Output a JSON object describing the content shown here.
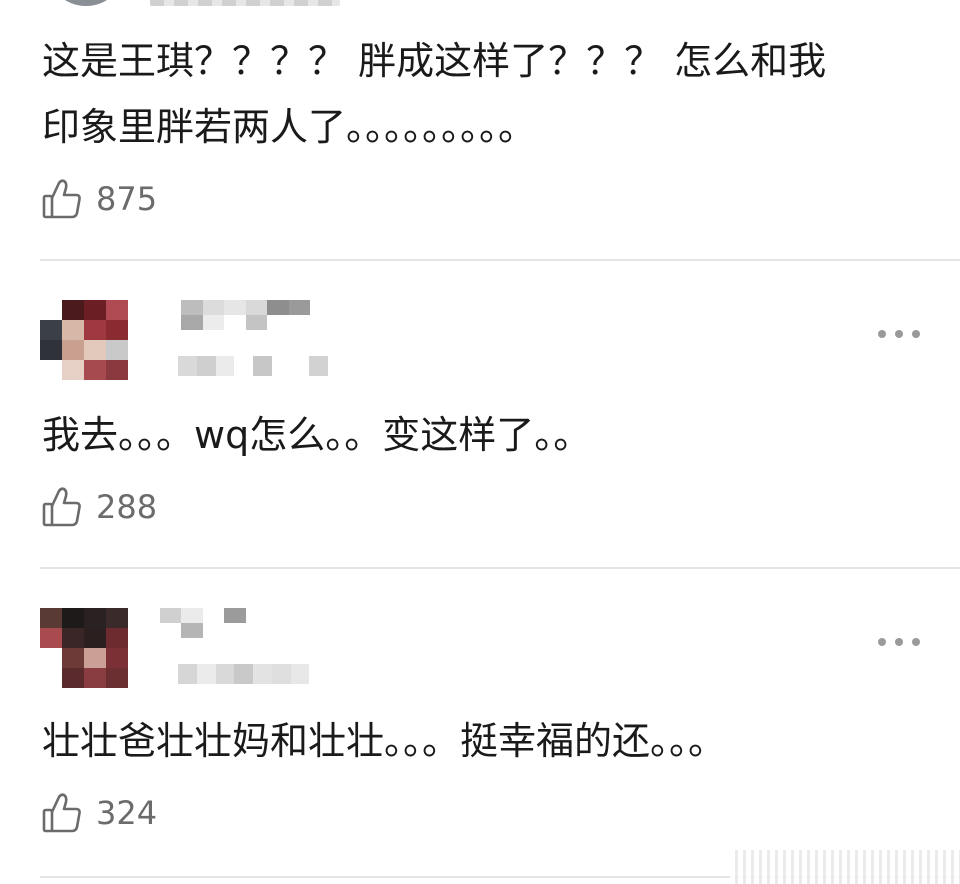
{
  "colors": {
    "text": "#1a1a1a",
    "secondary_text": "#6b6b6b",
    "divider": "#e5e5e5",
    "more_dots": "#9a9a9a"
  },
  "comments": [
    {
      "text": "这是王琪？？？？ 胖成这样了？？？ 怎么和我\n印象里胖若两人了。。。。。。。。。",
      "like_icon": "thumbs-up-icon",
      "like_count": "875"
    },
    {
      "text": "我去。。。wq怎么。。变这样了。。",
      "like_icon": "thumbs-up-icon",
      "like_count": "288",
      "more_icon": "more-dots-icon"
    },
    {
      "text": "壮壮爸壮壮妈和壮壮。。。挺幸福的还。。。",
      "like_icon": "thumbs-up-icon",
      "like_count": "324",
      "more_icon": "more-dots-icon"
    }
  ]
}
